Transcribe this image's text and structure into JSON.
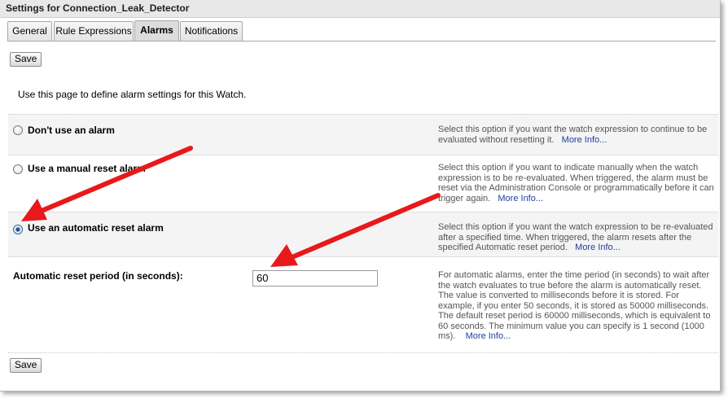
{
  "window": {
    "title": "Settings for Connection_Leak_Detector"
  },
  "tabs": [
    {
      "label": "General",
      "active": false
    },
    {
      "label": "Rule Expressions",
      "active": false
    },
    {
      "label": "Alarms",
      "active": true
    },
    {
      "label": "Notifications",
      "active": false
    }
  ],
  "toolbar": {
    "save_label": "Save"
  },
  "intro": "Use this page to define alarm settings for this Watch.",
  "options": [
    {
      "label": "Don't use an alarm",
      "checked": false,
      "help": "Select this option if you want the watch expression to continue to be evaluated without resetting it.",
      "more": "More Info..."
    },
    {
      "label": "Use a manual reset alarm",
      "checked": false,
      "help": "Select this option if you want to indicate manually when the watch expression is to be re-evaluated. When triggered, the alarm must be reset via the Administration Console or programmatically before it can trigger again.",
      "more": "More Info..."
    },
    {
      "label": "Use an automatic reset alarm",
      "checked": true,
      "help": "Select this option if you want the watch expression to be re-evaluated after a specified time. When triggered, the alarm resets after the specified Automatic reset period.",
      "more": "More Info..."
    }
  ],
  "reset_period": {
    "label": "Automatic reset period (in seconds):",
    "value": "60",
    "help": "For automatic alarms, enter the time period (in seconds) to wait after the watch evaluates to true before the alarm is automatically reset. The value is converted to milliseconds before it is stored. For example, if you enter 50 seconds, it is stored as 50000 milliseconds. The default reset period is 60000 milliseconds, which is equivalent to 60 seconds. The minimum value you can specify is 1 second (1000 ms).",
    "more": "More Info..."
  },
  "colors": {
    "annotation_arrow": "#e8191a",
    "link": "#1f3f9a"
  }
}
